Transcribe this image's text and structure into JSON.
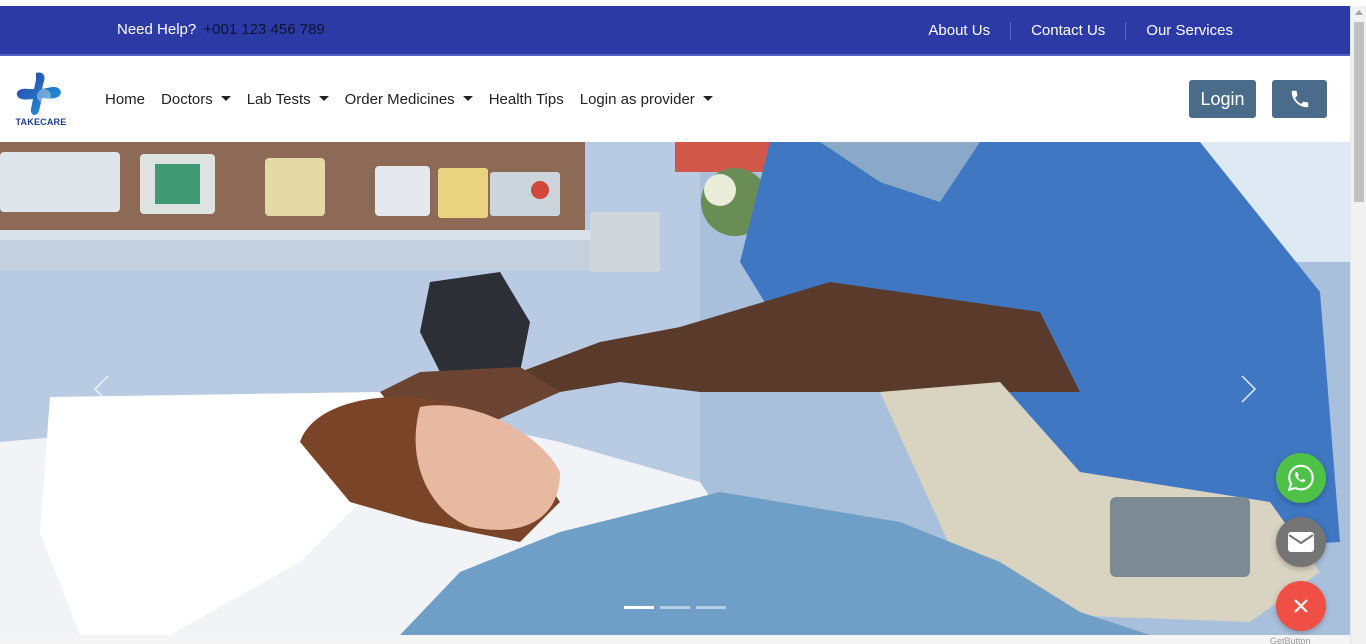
{
  "topbar": {
    "help_label": "Need Help?",
    "help_phone": "+001 123 456 789",
    "links": [
      "About Us",
      "Contact Us",
      "Our Services"
    ]
  },
  "brand": {
    "name": "TAKECARE"
  },
  "nav": {
    "items": [
      {
        "label": "Home",
        "dropdown": false
      },
      {
        "label": "Doctors",
        "dropdown": true
      },
      {
        "label": "Lab Tests",
        "dropdown": true
      },
      {
        "label": "Order Medicines",
        "dropdown": true
      },
      {
        "label": "Health Tips",
        "dropdown": false
      },
      {
        "label": "Login as provider",
        "dropdown": true
      }
    ],
    "login_label": "Login",
    "call_icon": "phone-icon"
  },
  "carousel": {
    "slide_count": 3,
    "active_slide": 1
  },
  "floating": {
    "whatsapp_icon": "whatsapp-icon",
    "mail_icon": "mail-icon",
    "close_icon": "close-icon"
  },
  "footer": {
    "getbutton_label": "GetButton"
  },
  "colors": {
    "topbar": "#2b3aa5",
    "button": "#4a6b8a",
    "whatsapp": "#4dc247",
    "close": "#ef4f45",
    "mail": "#757575"
  }
}
